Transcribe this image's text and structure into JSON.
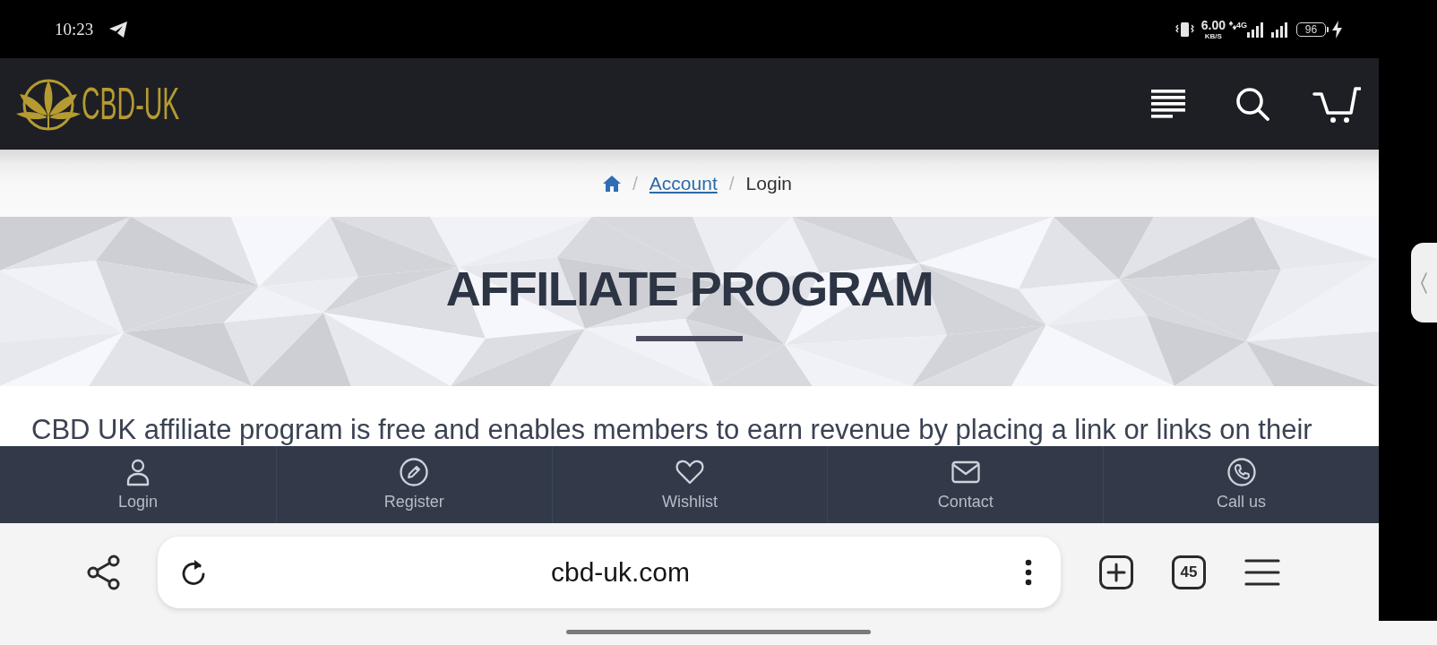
{
  "status_bar": {
    "time": "10:23",
    "network_speed": "6.00",
    "network_speed_unit": "KB/S",
    "network_type": "4G",
    "battery": "96",
    "charging": true
  },
  "header": {
    "logo_text": "CBD-UK"
  },
  "breadcrumb": [
    {
      "kind": "home"
    },
    {
      "kind": "link",
      "separator": "/",
      "label": "Account"
    },
    {
      "kind": "current",
      "separator": "/",
      "label": "Login"
    }
  ],
  "hero": {
    "title": "AFFILIATE PROGRAM"
  },
  "intro": {
    "text": "CBD UK affiliate program is free and enables members to earn revenue by placing a link or links on their"
  },
  "bottom_nav": [
    {
      "kind": "login",
      "label": "Login"
    },
    {
      "kind": "register",
      "label": "Register"
    },
    {
      "kind": "wishlist",
      "label": "Wishlist"
    },
    {
      "kind": "contact",
      "label": "Contact"
    },
    {
      "kind": "call",
      "label": "Call us"
    }
  ],
  "browser_toolbar": {
    "url": "cbd-uk.com",
    "tab_count": "45"
  }
}
